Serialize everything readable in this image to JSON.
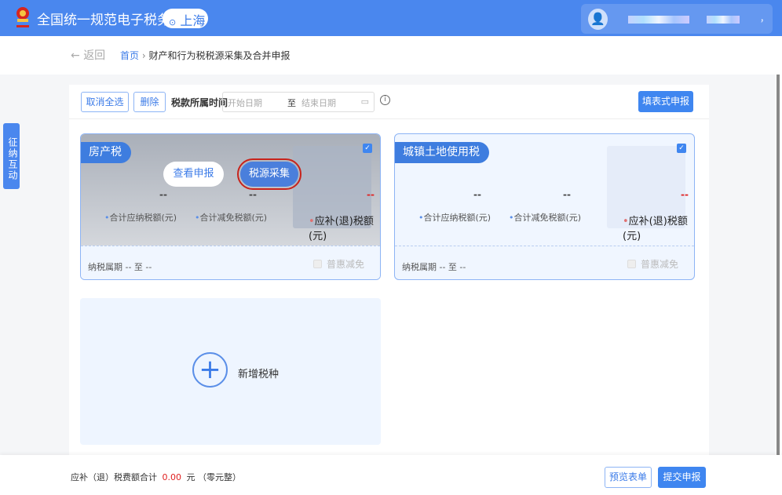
{
  "header": {
    "title": "全国统一规范电子税务局",
    "city": "上海",
    "user_suffix": "，"
  },
  "breadcrumb": {
    "back": "返回",
    "home": "首页",
    "sep": "›",
    "current": "财产和行为税税源采集及合并申报"
  },
  "side_tab": "征纳互动",
  "toolbar": {
    "deselect_all": "取消全选",
    "delete": "删除",
    "period_label": "税款所属时间",
    "start_placeholder": "开始日期",
    "to": "至",
    "end_placeholder": "结束日期",
    "fill_form": "填表式申报"
  },
  "cards": [
    {
      "name": "房产税",
      "checked": true,
      "view": "查看申报",
      "collect": "税源采集",
      "total_payable": "--",
      "total_relief": "--",
      "refund": "--",
      "label_payable": "合计应纳税额(元)",
      "label_relief": "合计减免税额(元)",
      "label_refund": "应补(退)税额(元)",
      "period": "纳税属期 -- 至 --",
      "benefit": "普惠减免"
    },
    {
      "name": "城镇土地使用税",
      "checked": true,
      "total_payable": "--",
      "total_relief": "--",
      "refund": "--",
      "label_payable": "合计应纳税额(元)",
      "label_relief": "合计减免税额(元)",
      "label_refund": "应补(退)税额(元)",
      "period": "纳税属期 -- 至 --",
      "benefit": "普惠减免"
    }
  ],
  "add": {
    "label": "新增税种"
  },
  "footer": {
    "total_label": "应补（退）税费额合计",
    "amount": "0.00",
    "unit": "元",
    "words": "（零元整）",
    "preview": "预览表单",
    "submit": "提交申报"
  },
  "colors": {
    "primary": "#4a87ee",
    "danger": "#e02020"
  }
}
